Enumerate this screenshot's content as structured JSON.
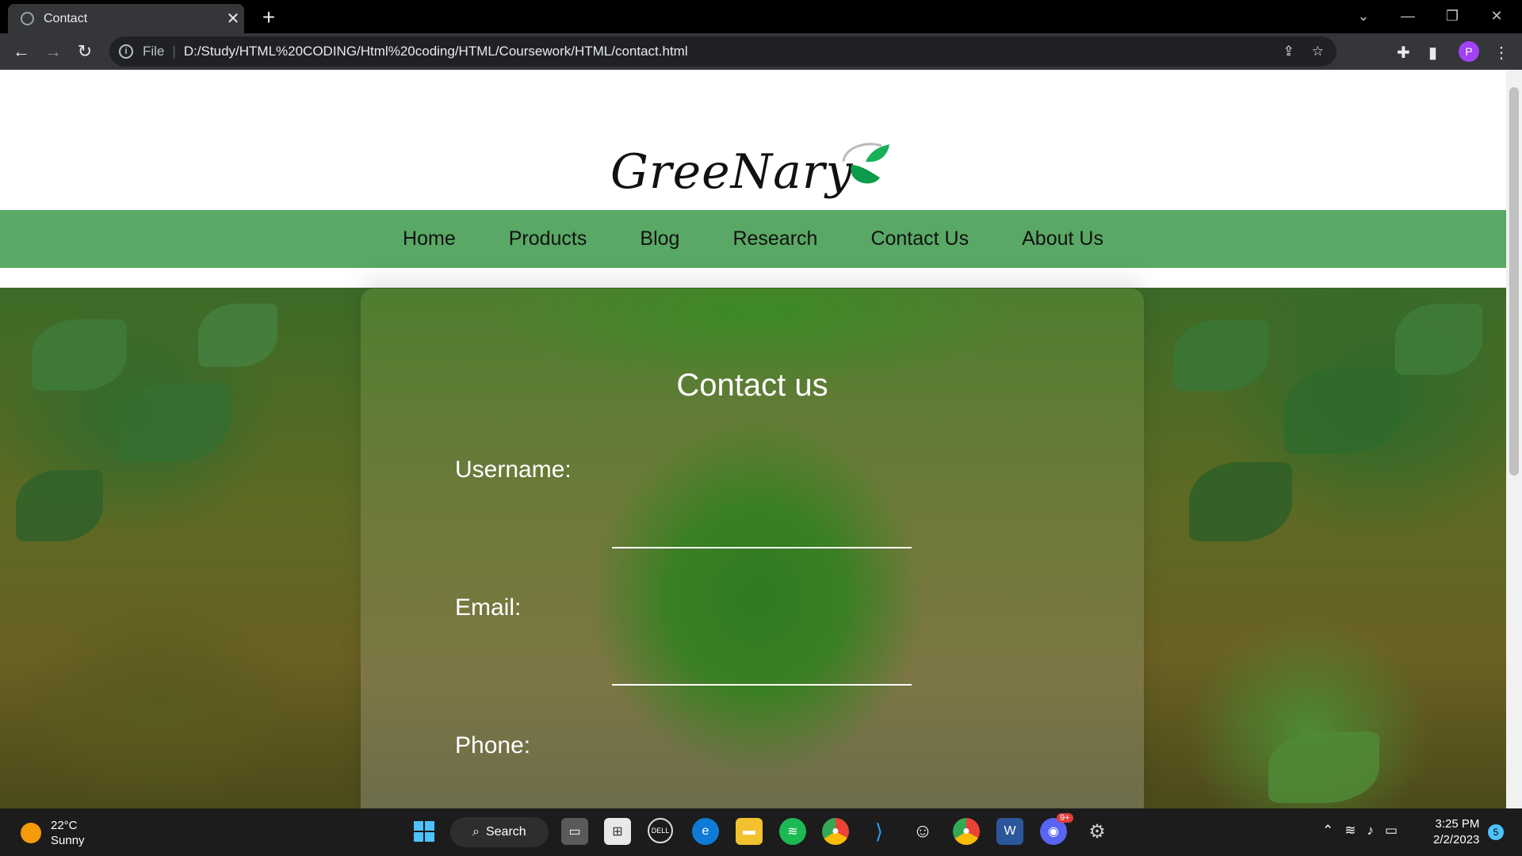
{
  "browser": {
    "tab_title": "Contact",
    "url_prefix": "File",
    "url": "D:/Study/HTML%20CODING/Html%20coding/HTML/Coursework/HTML/contact.html",
    "profile_initial": "P"
  },
  "site": {
    "logo_text": "GreeNary",
    "nav": [
      "Home",
      "Products",
      "Blog",
      "Research",
      "Contact Us",
      "About Us"
    ]
  },
  "contact_form": {
    "heading": "Contact us",
    "username_label": "Username:",
    "email_label": "Email:",
    "phone_label": "Phone:"
  },
  "taskbar": {
    "temperature": "22°C",
    "condition": "Sunny",
    "search_label": "Search",
    "time": "3:25 PM",
    "date": "2/2/2023",
    "notification_count": "5",
    "discord_badge": "9+"
  }
}
